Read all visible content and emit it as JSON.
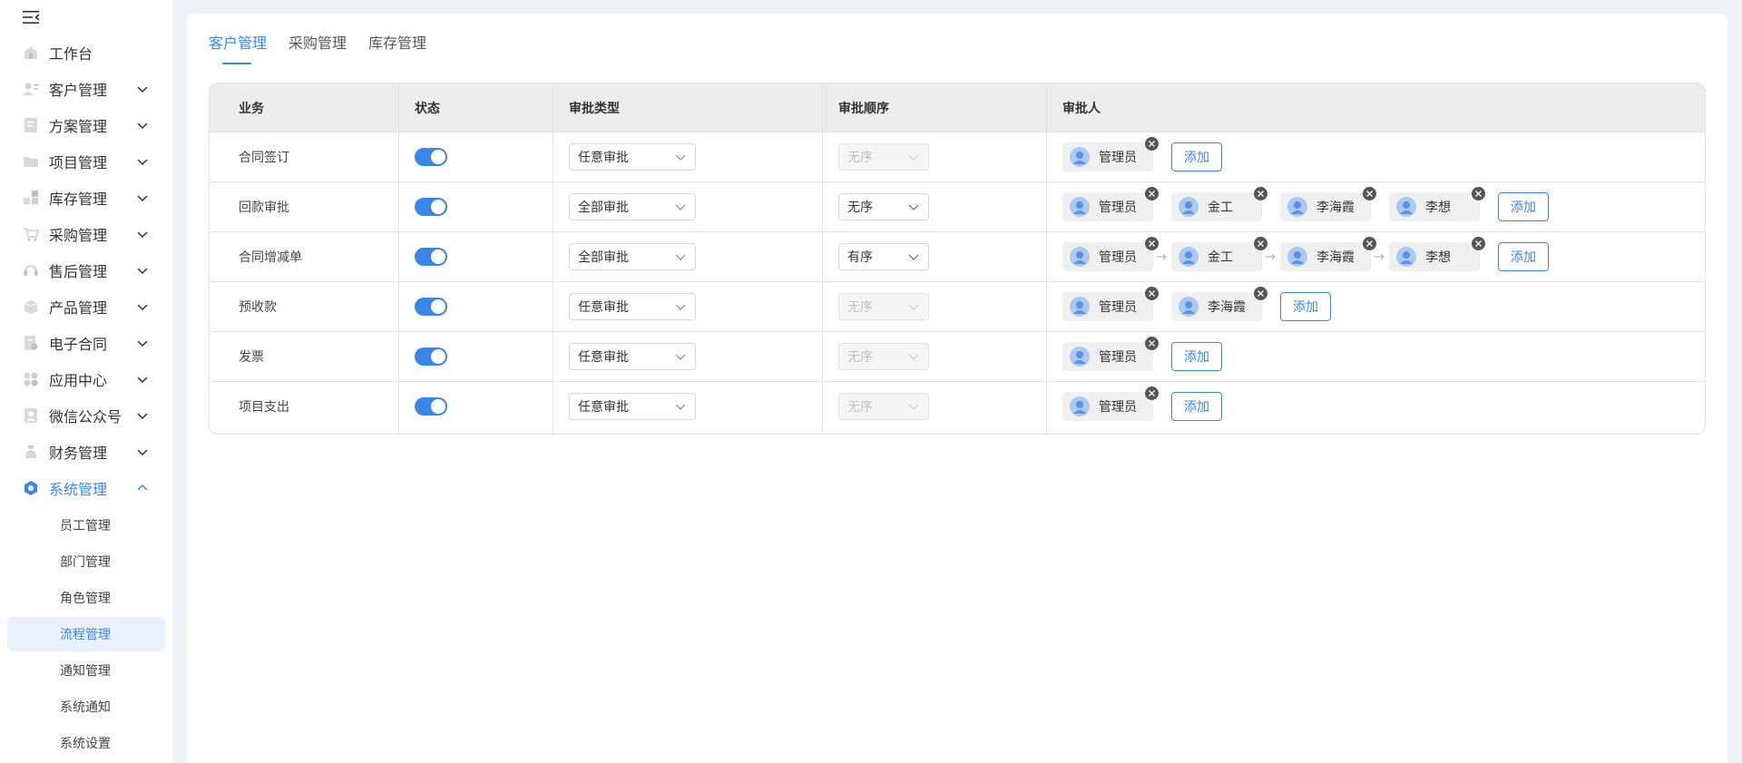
{
  "sidebar": {
    "items": [
      {
        "label": "工作台",
        "icon": "home-icon",
        "expandable": false
      },
      {
        "label": "客户管理",
        "icon": "customer-icon",
        "expandable": true
      },
      {
        "label": "方案管理",
        "icon": "plan-icon",
        "expandable": true
      },
      {
        "label": "项目管理",
        "icon": "folder-icon",
        "expandable": true
      },
      {
        "label": "库存管理",
        "icon": "inventory-icon",
        "expandable": true
      },
      {
        "label": "采购管理",
        "icon": "cart-icon",
        "expandable": true
      },
      {
        "label": "售后管理",
        "icon": "headset-icon",
        "expandable": true
      },
      {
        "label": "产品管理",
        "icon": "box-icon",
        "expandable": true
      },
      {
        "label": "电子合同",
        "icon": "contract-icon",
        "expandable": true
      },
      {
        "label": "应用中心",
        "icon": "apps-icon",
        "expandable": true
      },
      {
        "label": "微信公众号",
        "icon": "wechat-icon",
        "expandable": true
      },
      {
        "label": "财务管理",
        "icon": "finance-icon",
        "expandable": true
      },
      {
        "label": "系统管理",
        "icon": "settings-hex-icon",
        "expandable": true,
        "expanded": true
      }
    ],
    "subitems": [
      "员工管理",
      "部门管理",
      "角色管理",
      "流程管理",
      "通知管理",
      "系统通知",
      "系统设置"
    ],
    "selected_sub": "流程管理"
  },
  "tabs": [
    "客户管理",
    "采购管理",
    "库存管理"
  ],
  "active_tab": "客户管理",
  "table": {
    "headers": [
      "业务",
      "状态",
      "审批类型",
      "审批顺序",
      "审批人"
    ],
    "add_label": "添加",
    "rows": [
      {
        "business": "合同签订",
        "enabled": true,
        "type": "任意审批",
        "order": "无序",
        "order_disabled": true,
        "approvers": [
          "管理员"
        ]
      },
      {
        "business": "回款审批",
        "enabled": true,
        "type": "全部审批",
        "order": "无序",
        "order_disabled": false,
        "approvers": [
          "管理员",
          "金工",
          "李海霞",
          "李想"
        ]
      },
      {
        "business": "合同增减单",
        "enabled": true,
        "type": "全部审批",
        "order": "有序",
        "order_disabled": false,
        "approvers": [
          "管理员",
          "金工",
          "李海霞",
          "李想"
        ],
        "sequential": true
      },
      {
        "business": "预收款",
        "enabled": true,
        "type": "任意审批",
        "order": "无序",
        "order_disabled": true,
        "approvers": [
          "管理员",
          "李海霞"
        ]
      },
      {
        "business": "发票",
        "enabled": true,
        "type": "任意审批",
        "order": "无序",
        "order_disabled": true,
        "approvers": [
          "管理员"
        ]
      },
      {
        "business": "项目支出",
        "enabled": true,
        "type": "任意审批",
        "order": "无序",
        "order_disabled": true,
        "approvers": [
          "管理员"
        ]
      }
    ]
  },
  "colors": {
    "accent": "#3a86e8",
    "header_bg": "#ececec",
    "page_bg": "#eef1f6"
  }
}
